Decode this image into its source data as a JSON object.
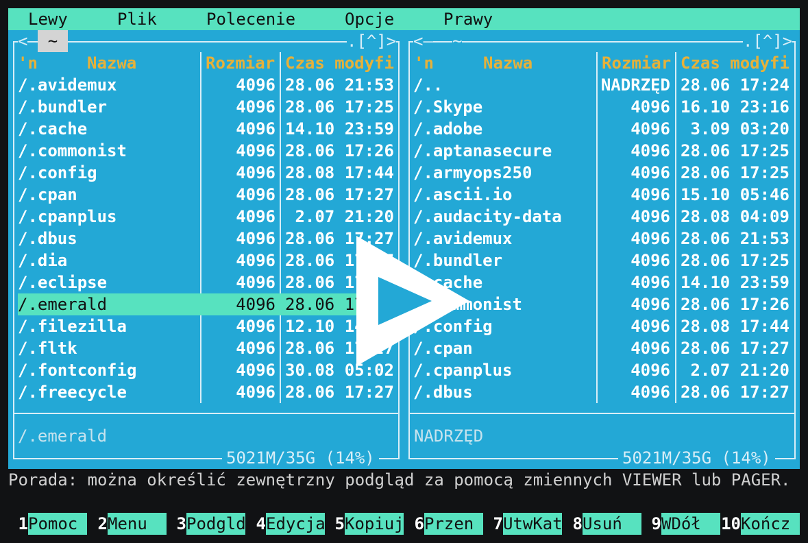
{
  "menubar": {
    "items": [
      "Lewy",
      "Plik",
      "Polecenie",
      "Opcje",
      "Prawy"
    ]
  },
  "left_panel": {
    "path": "~",
    "corner_left": "<",
    "corner_right": ".[^]>",
    "headers": {
      "name": "Nazwa",
      "sort": "'n",
      "size": "Rozmiar",
      "time": "Czas modyfi"
    },
    "rows": [
      {
        "name": "/.avidemux",
        "size": "4096",
        "time": "28.06 21:53"
      },
      {
        "name": "/.bundler",
        "size": "4096",
        "time": "28.06 17:25"
      },
      {
        "name": "/.cache",
        "size": "4096",
        "time": "14.10 23:59"
      },
      {
        "name": "/.commonist",
        "size": "4096",
        "time": "28.06 17:26"
      },
      {
        "name": "/.config",
        "size": "4096",
        "time": "28.08 17:44"
      },
      {
        "name": "/.cpan",
        "size": "4096",
        "time": "28.06 17:27"
      },
      {
        "name": "/.cpanplus",
        "size": "4096",
        "time": " 2.07 21:20"
      },
      {
        "name": "/.dbus",
        "size": "4096",
        "time": "28.06 17:27"
      },
      {
        "name": "/.dia",
        "size": "4096",
        "time": "28.06 17:27"
      },
      {
        "name": "/.eclipse",
        "size": "4096",
        "time": "28.06 17:27"
      },
      {
        "name": "/.emerald",
        "size": "4096",
        "time": "28.06 17:27",
        "selected": true
      },
      {
        "name": "/.filezilla",
        "size": "4096",
        "time": "12.10 14:39"
      },
      {
        "name": "/.fltk",
        "size": "4096",
        "time": "28.06 17:27"
      },
      {
        "name": "/.fontconfig",
        "size": "4096",
        "time": "30.08 05:02"
      },
      {
        "name": "/.freecycle",
        "size": "4096",
        "time": "28.06 17:27"
      }
    ],
    "mini_status": "/.emerald",
    "disk": "5021M/35G (14%)"
  },
  "right_panel": {
    "path": "~",
    "corner_left": "<—",
    "corner_right": ".[^]>",
    "headers": {
      "name": "Nazwa",
      "sort": "'n",
      "size": "Rozmiar",
      "time": "Czas modyfi"
    },
    "rows": [
      {
        "name": "/..",
        "size": "NADRZĘD",
        "time": "28.06 17:24"
      },
      {
        "name": "/.Skype",
        "size": "4096",
        "time": "16.10 23:16"
      },
      {
        "name": "/.adobe",
        "size": "4096",
        "time": " 3.09 03:20"
      },
      {
        "name": "/.aptanasecure",
        "size": "4096",
        "time": "28.06 17:25"
      },
      {
        "name": "/.armyops250",
        "size": "4096",
        "time": "28.06 17:25"
      },
      {
        "name": "/.ascii.io",
        "size": "4096",
        "time": "15.10 05:46"
      },
      {
        "name": "/.audacity-data",
        "size": "4096",
        "time": "28.08 04:09"
      },
      {
        "name": "/.avidemux",
        "size": "4096",
        "time": "28.06 21:53"
      },
      {
        "name": "/.bundler",
        "size": "4096",
        "time": "28.06 17:25"
      },
      {
        "name": "/.cache",
        "size": "4096",
        "time": "14.10 23:59"
      },
      {
        "name": "/.commonist",
        "size": "4096",
        "time": "28.06 17:26"
      },
      {
        "name": "/.config",
        "size": "4096",
        "time": "28.08 17:44"
      },
      {
        "name": "/.cpan",
        "size": "4096",
        "time": "28.06 17:27"
      },
      {
        "name": "/.cpanplus",
        "size": "4096",
        "time": " 2.07 21:20"
      },
      {
        "name": "/.dbus",
        "size": "4096",
        "time": "28.06 17:27"
      }
    ],
    "mini_status": "NADRZĘD",
    "disk": "5021M/35G (14%)"
  },
  "hint": "Porada: można określić zewnętrzny podgląd za pomocą zmiennych VIEWER lub PAGER.",
  "fkeys": [
    {
      "num": "1",
      "label": "Pomoc"
    },
    {
      "num": "2",
      "label": "Menu"
    },
    {
      "num": "3",
      "label": "Podgld"
    },
    {
      "num": "4",
      "label": "Edycja"
    },
    {
      "num": "5",
      "label": "Kopiuj"
    },
    {
      "num": "6",
      "label": "Przen"
    },
    {
      "num": "7",
      "label": "UtwKat"
    },
    {
      "num": "8",
      "label": "Usuń"
    },
    {
      "num": "9",
      "label": "WDół"
    },
    {
      "num": "10",
      "label": "Kończ"
    }
  ],
  "overlay": {
    "icon": "play-icon"
  },
  "colors": {
    "panel_bg": "#23a8d6",
    "menubar_bg": "#57e2bf",
    "header_text": "#e6b13a",
    "selection_bg": "#57e2bf",
    "terminal_bg": "#111214"
  }
}
